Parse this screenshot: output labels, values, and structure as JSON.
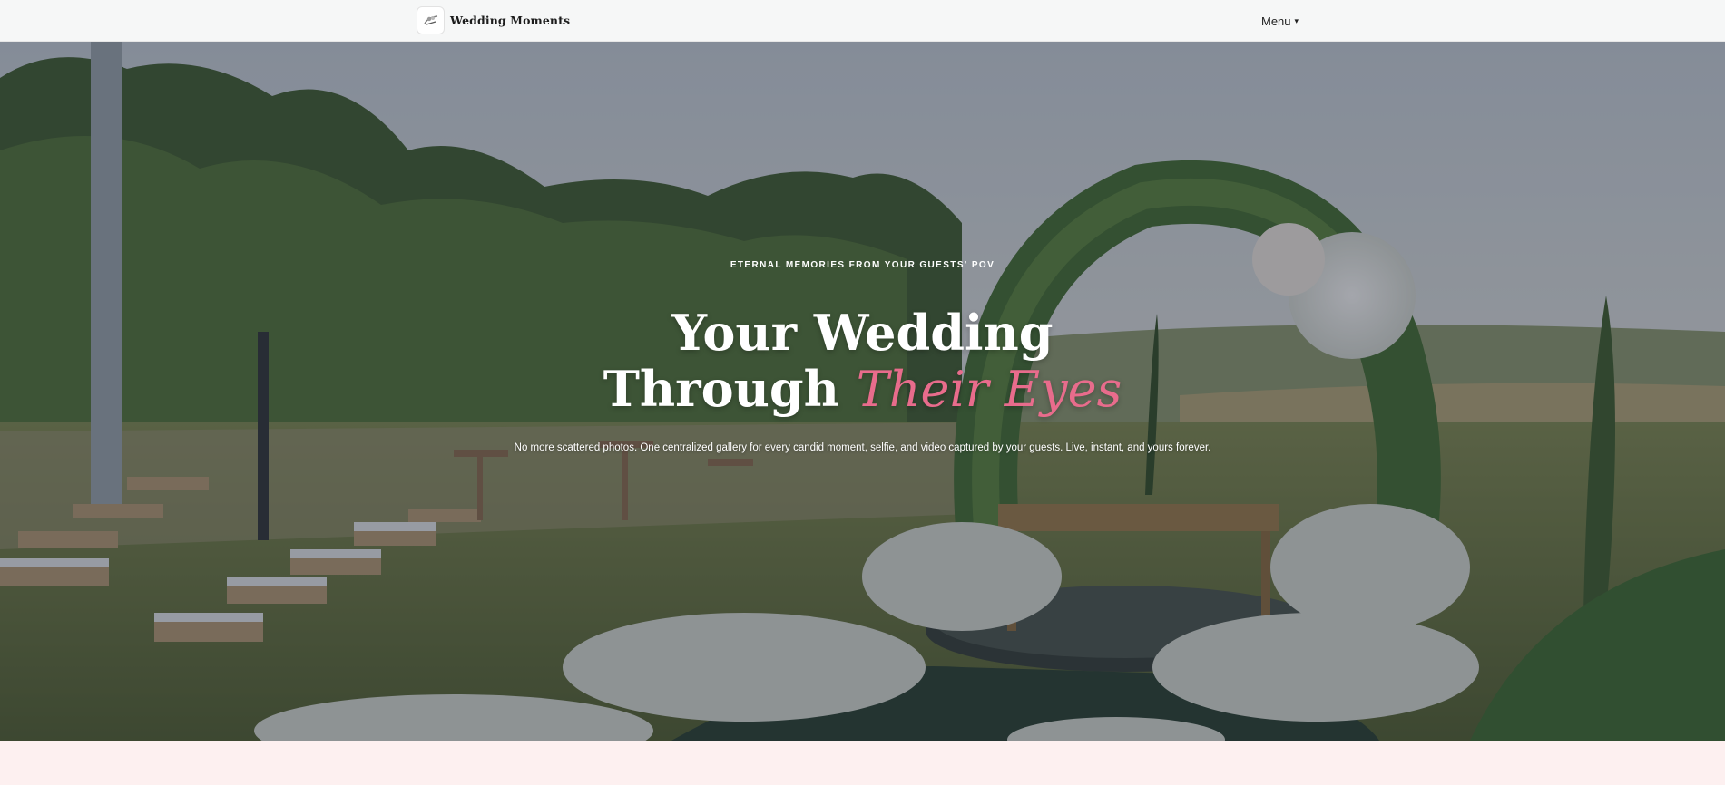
{
  "header": {
    "brand_name": "Wedding Moments",
    "logo_icon": "couple-illustration-icon",
    "menu_label": "Menu",
    "menu_caret": "▾"
  },
  "hero": {
    "eyebrow": "ETERNAL MEMORIES FROM YOUR GUESTS' POV",
    "title_line1": "Your Wedding",
    "title_line2_plain": "Through",
    "title_line2_accent": "Their Eyes",
    "subtitle": "No more scattered photos. One centralized gallery for every candid moment, selfie, and video captured by your guests. Live, instant, and yours forever.",
    "background_image": "outdoor wedding ceremony with chairs, floral arch and wooden table"
  },
  "colors": {
    "accent": "#e86c8c",
    "header_bg": "#f6f7f7",
    "page_bg": "#fdf0f0"
  }
}
